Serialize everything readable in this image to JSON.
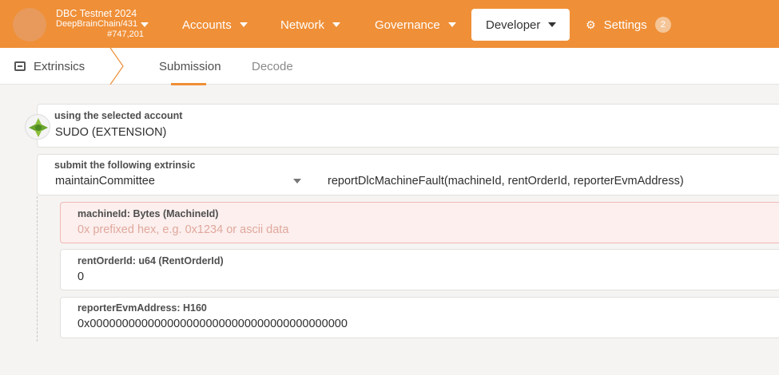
{
  "header": {
    "chain_name": "DBC Testnet 2024",
    "chain_runtime": "DeepBrainChain/431",
    "block_number": "#747,201",
    "menu": {
      "accounts": "Accounts",
      "network": "Network",
      "governance": "Governance",
      "developer": "Developer",
      "settings": "Settings",
      "settings_badge": "2"
    }
  },
  "subnav": {
    "title": "Extrinsics",
    "tabs": [
      "Submission",
      "Decode"
    ],
    "active_tab": "Submission"
  },
  "account": {
    "label": "using the selected account",
    "value": "SUDO (EXTENSION)"
  },
  "extrinsic": {
    "label": "submit the following extrinsic",
    "module": "maintainCommittee",
    "call": "reportDlcMachineFault(machineId, rentOrderId, reporterEvmAddress)"
  },
  "params": {
    "machine_id": {
      "label": "machineId: Bytes (MachineId)",
      "placeholder": "0x prefixed hex, e.g. 0x1234 or ascii data"
    },
    "rent_order_id": {
      "label": "rentOrderId: u64 (RentOrderId)",
      "value": "0"
    },
    "reporter_evm_address": {
      "label": "reporterEvmAddress: H160",
      "value": "0x0000000000000000000000000000000000000000"
    }
  },
  "colors": {
    "brand": "#ef8f37",
    "error_bg": "#fcefee",
    "error_border": "#f0b9b5"
  }
}
